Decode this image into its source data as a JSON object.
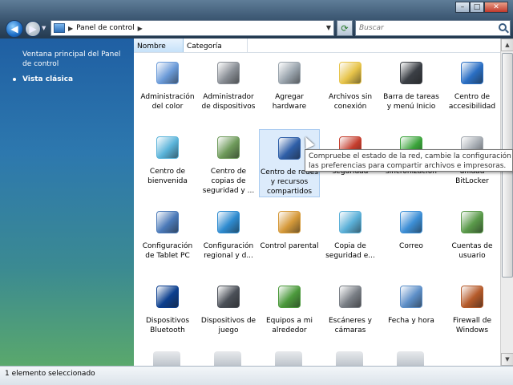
{
  "nav": {
    "address": "Panel de control",
    "search_placeholder": "Buscar"
  },
  "left_pane": {
    "main_link": "Ventana principal del Panel de control",
    "classic_view": "Vista clásica"
  },
  "columns": {
    "name": "Nombre",
    "category": "Categoría"
  },
  "items": [
    {
      "label": "Administración del color",
      "icon": "color-management-icon",
      "color": "#6a9ad8"
    },
    {
      "label": "Administrador de dispositivos",
      "icon": "device-manager-icon",
      "color": "#8a8f96"
    },
    {
      "label": "Agregar hardware",
      "icon": "add-hardware-icon",
      "color": "#9aa4ad"
    },
    {
      "label": "Archivos sin conexión",
      "icon": "offline-files-icon",
      "color": "#e7c44a"
    },
    {
      "label": "Barra de tareas y menú Inicio",
      "icon": "taskbar-icon",
      "color": "#3b3f45"
    },
    {
      "label": "Centro de accesibilidad",
      "icon": "accessibility-icon",
      "color": "#2a6fc4"
    },
    {
      "label": "Centro de bienvenida",
      "icon": "welcome-center-icon",
      "color": "#59b3d9"
    },
    {
      "label": "Centro de copias de seguridad y ...",
      "icon": "backup-icon",
      "color": "#6e9a5a"
    },
    {
      "label": "Centro de redes y recursos compartidos",
      "icon": "network-center-icon",
      "color": "#2f5fa8"
    },
    {
      "label": "seguridad",
      "icon": "security-center-icon",
      "color": "#c53d2d"
    },
    {
      "label": "sincronización",
      "icon": "sync-center-icon",
      "color": "#3aa33a"
    },
    {
      "label": "unidad BitLocker",
      "icon": "bitlocker-icon",
      "color": "#a0a6ad"
    },
    {
      "label": "Configuración de Tablet PC",
      "icon": "tablet-pc-icon",
      "color": "#4a79b8"
    },
    {
      "label": "Configuración regional y d...",
      "icon": "regional-settings-icon",
      "color": "#2e8bd0"
    },
    {
      "label": "Control parental",
      "icon": "parental-controls-icon",
      "color": "#d69a3a"
    },
    {
      "label": "Copia de seguridad e...",
      "icon": "backup-restore-icon",
      "color": "#5bb0d8"
    },
    {
      "label": "Correo",
      "icon": "mail-icon",
      "color": "#3d8fd6"
    },
    {
      "label": "Cuentas de usuario",
      "icon": "user-accounts-icon",
      "color": "#5a9a4a"
    },
    {
      "label": "Dispositivos Bluetooth",
      "icon": "bluetooth-icon",
      "color": "#0c3f8f"
    },
    {
      "label": "Dispositivos de juego",
      "icon": "game-controllers-icon",
      "color": "#4b5058"
    },
    {
      "label": "Equipos a mi alrededor",
      "icon": "people-near-me-icon",
      "color": "#4c9a3c"
    },
    {
      "label": "Escáneres y cámaras",
      "icon": "scanners-cameras-icon",
      "color": "#7a7f86"
    },
    {
      "label": "Fecha y hora",
      "icon": "date-time-icon",
      "color": "#5d8fc8"
    },
    {
      "label": "Firewall de Windows",
      "icon": "firewall-icon",
      "color": "#b55a2a"
    }
  ],
  "tooltip": {
    "line1": "Compruebe el estado de la red, cambie la configuración de re",
    "line2": "las preferencias para compartir archivos e impresoras."
  },
  "status": "1 elemento seleccionado"
}
